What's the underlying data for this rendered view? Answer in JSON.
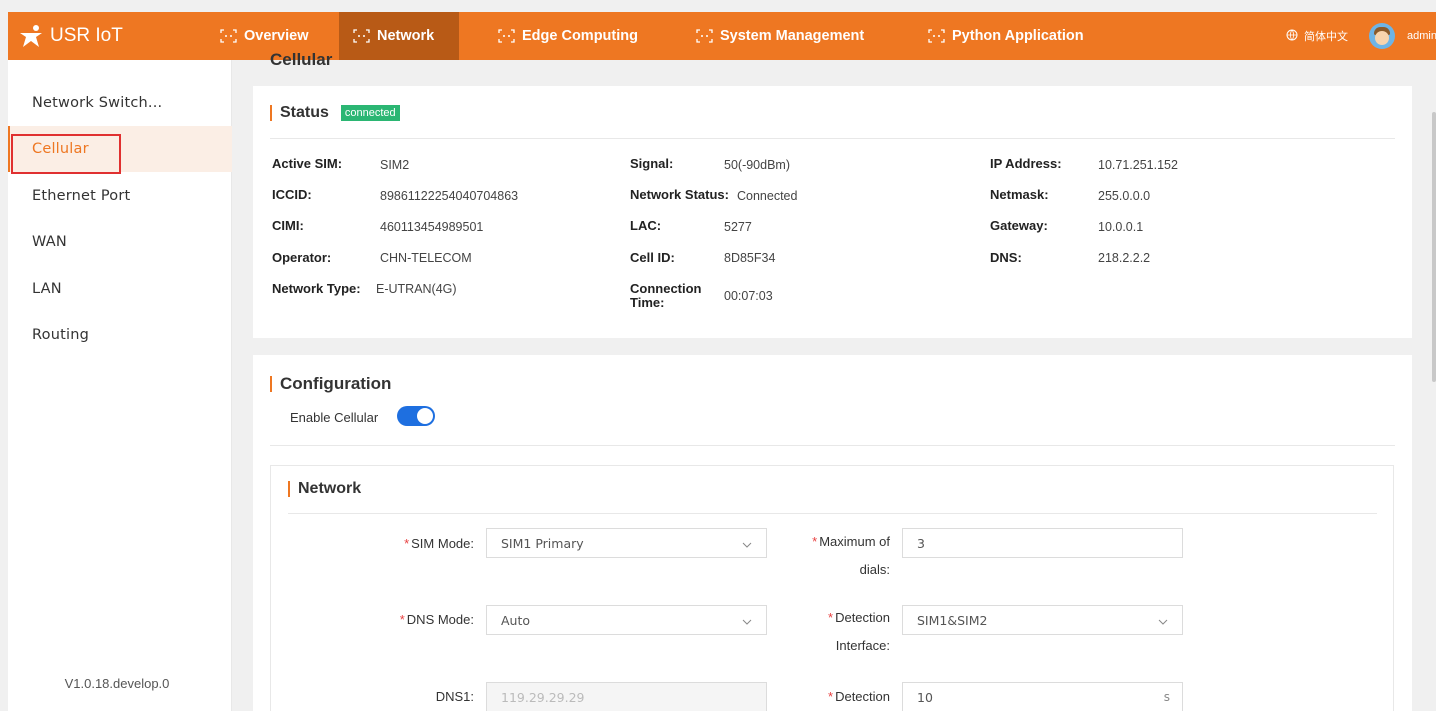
{
  "app": {
    "brand": "USR IoT",
    "nav": [
      "Overview",
      "Network",
      "Edge Computing",
      "System Management",
      "Python Application"
    ],
    "language": "简体中文",
    "user": "admin"
  },
  "sidebar": {
    "items": [
      "Network Switch...",
      "Cellular",
      "Ethernet Port",
      "WAN",
      "LAN",
      "Routing"
    ],
    "version": "V1.0.18.develop.0"
  },
  "page": {
    "title": "Cellular"
  },
  "status": {
    "title": "Status",
    "badge": "connected",
    "fields": [
      {
        "label": "Active SIM:",
        "value": "SIM2"
      },
      {
        "label": "ICCID:",
        "value": "89861122254040704863"
      },
      {
        "label": "CIMI:",
        "value": "460113454989501"
      },
      {
        "label": "Operator:",
        "value": "CHN-TELECOM"
      },
      {
        "label": "Network Type:",
        "value": "E-UTRAN(4G)"
      },
      {
        "label": "Signal:",
        "value": "50(-90dBm)"
      },
      {
        "label": "Network Status:",
        "value": "Connected"
      },
      {
        "label": "LAC:",
        "value": "5277"
      },
      {
        "label": "Cell ID:",
        "value": "8D85F34"
      },
      {
        "label": "Connection Time:",
        "value": "00:07:03"
      },
      {
        "label": "IP Address:",
        "value": "10.71.251.152"
      },
      {
        "label": "Netmask:",
        "value": "255.0.0.0"
      },
      {
        "label": "Gateway:",
        "value": "10.0.0.1"
      },
      {
        "label": "DNS:",
        "value": "218.2.2.2"
      }
    ]
  },
  "configuration": {
    "title": "Configuration",
    "enable_label": "Enable Cellular",
    "enabled": true
  },
  "network": {
    "title": "Network",
    "sim_mode": {
      "label": "SIM Mode:",
      "value": "SIM1 Primary"
    },
    "max_dials": {
      "label": "Maximum of dials:",
      "value": "3"
    },
    "dns_mode": {
      "label": "DNS Mode:",
      "value": "Auto"
    },
    "detection_interface": {
      "label": "Detection Interface:",
      "value": "SIM1&SIM2"
    },
    "dns1": {
      "label": "DNS1:",
      "value": "119.29.29.29"
    },
    "detection": {
      "label": "Detection",
      "value": "10",
      "suffix": "s"
    }
  },
  "colors": {
    "accent": "#ee7722",
    "nav_active": "#b85a16",
    "badge": "#2bb673",
    "toggle": "#1e6fe0",
    "required": "#e84040"
  }
}
